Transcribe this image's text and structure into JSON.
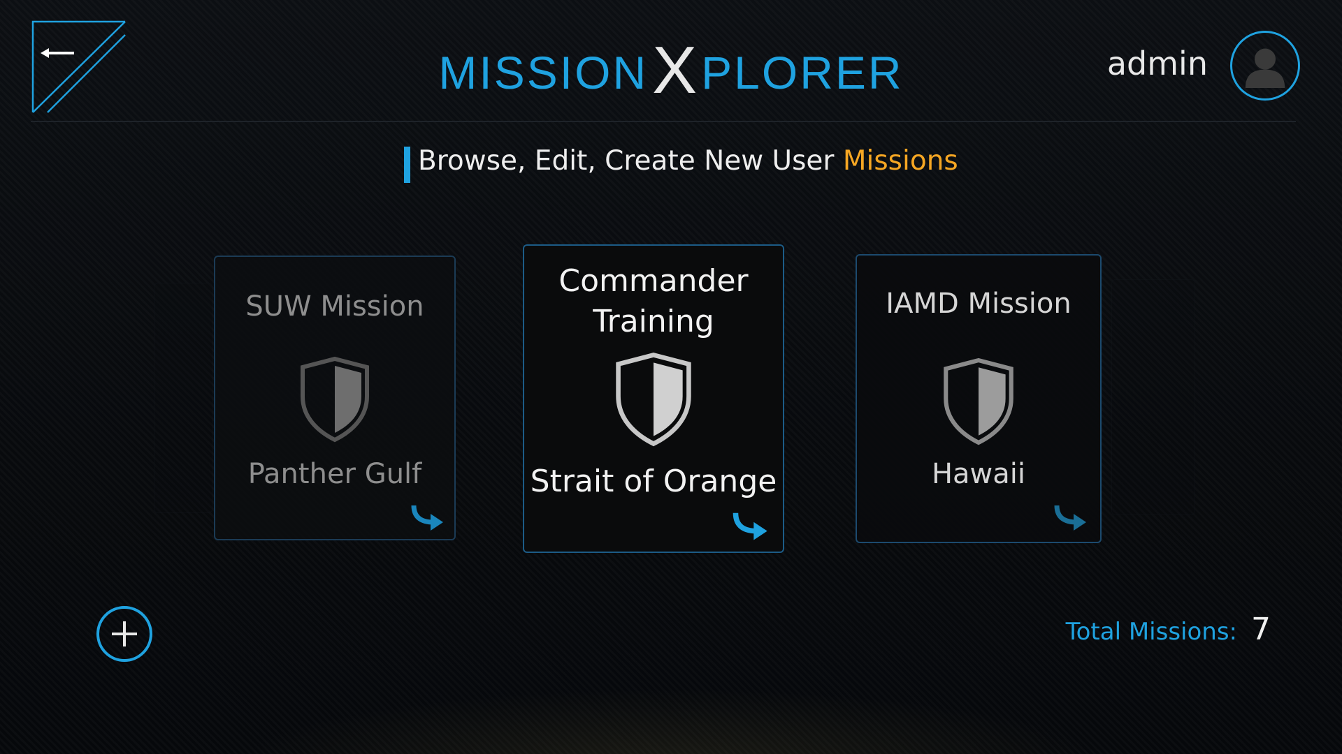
{
  "header": {
    "logo_left": "MISSION",
    "logo_x": "X",
    "logo_right": "PLORER",
    "user_name": "admin"
  },
  "subtitle": {
    "text": "Browse, Edit, Create New User",
    "accent": "Missions"
  },
  "cards": [
    {
      "title": "SUW Mission",
      "location": "Panther Gulf",
      "state": "side"
    },
    {
      "title": "Commander Training",
      "title_line1": "Commander",
      "title_line2": "Training",
      "location": "Strait of Orange",
      "state": "selected"
    },
    {
      "title": "IAMD Mission",
      "location": "Hawaii",
      "state": "side"
    }
  ],
  "footer": {
    "total_label": "Total Missions:",
    "total_count": "7"
  },
  "icons": {
    "back": "back-arrow-icon",
    "avatar": "user-avatar-icon",
    "mission": "shield-icon",
    "open": "open-arrow-icon",
    "add": "plus-icon"
  },
  "colors": {
    "accent": "#1fa2e0",
    "highlight": "#f5a623",
    "background": "#0a0c0f"
  }
}
